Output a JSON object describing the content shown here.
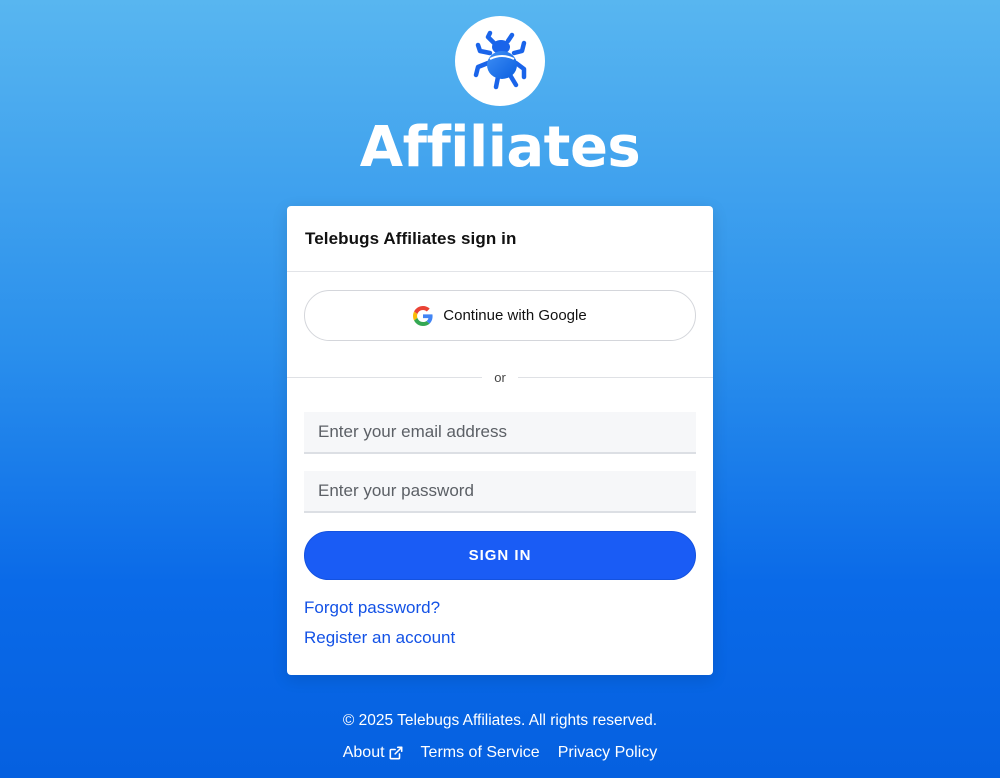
{
  "brand": {
    "logo_icon": "bug-icon",
    "title": "Affiliates"
  },
  "signin": {
    "title": "Telebugs Affiliates sign in",
    "google_label": "Continue with Google",
    "divider_text": "or",
    "email_placeholder": "Enter your email address",
    "password_placeholder": "Enter your password",
    "submit_label": "SIGN IN",
    "forgot_password": "Forgot password?",
    "register": "Register an account"
  },
  "footer": {
    "copyright": "© 2025 Telebugs Affiliates. All rights reserved.",
    "links": [
      {
        "label": "About",
        "icon": "external-link-icon"
      },
      {
        "label": "Terms of Service"
      },
      {
        "label": "Privacy Policy"
      }
    ]
  },
  "colors": {
    "accent": "#1a5cf5",
    "link": "#1352e6",
    "background_top": "#58b6f0",
    "background_bottom": "#0560e0"
  }
}
